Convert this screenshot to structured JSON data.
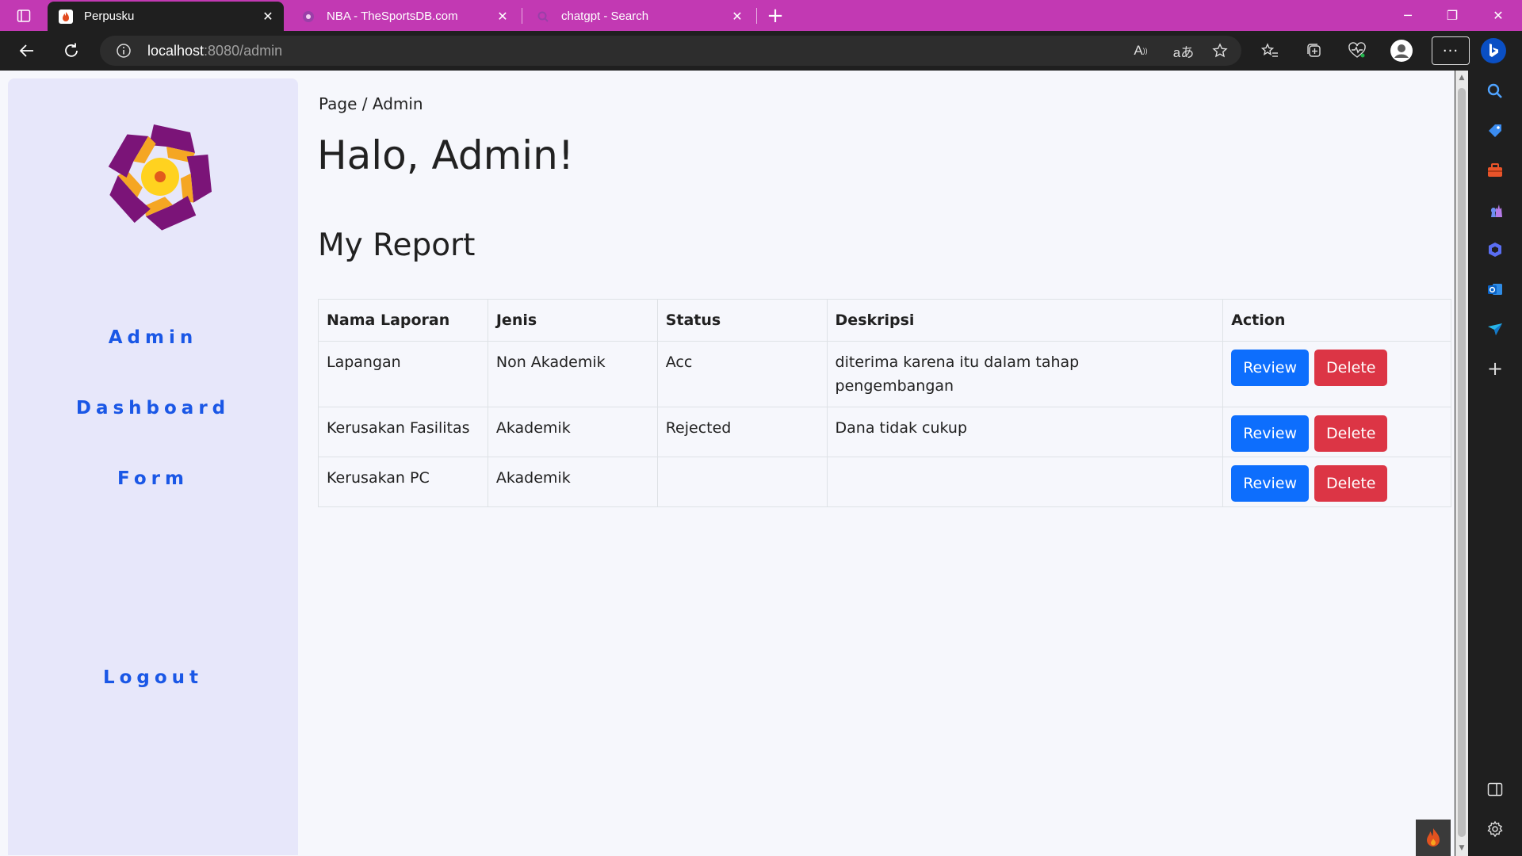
{
  "browser": {
    "tabs": [
      {
        "title": "Perpusku",
        "active": true,
        "icon": "fire-favicon-icon"
      },
      {
        "title": "NBA - TheSportsDB.com",
        "active": false,
        "icon": "sportsdb-favicon-icon"
      },
      {
        "title": "chatgpt - Search",
        "active": false,
        "icon": "search-favicon-icon"
      }
    ],
    "url_host": "localhost",
    "url_rest": ":8080/admin",
    "read_aloud_label": "A",
    "translate_label": "aあ",
    "titlebar_color": "#c239b3"
  },
  "sidebar": {
    "nav": [
      {
        "label": "Admin"
      },
      {
        "label": "Dashboard"
      },
      {
        "label": "Form"
      }
    ],
    "logout_label": "Logout",
    "accent": "#1a57e6"
  },
  "main": {
    "breadcrumb": "Page / Admin",
    "greeting": "Halo, Admin!",
    "section_title": "My Report",
    "table": {
      "headers": [
        "Nama Laporan",
        "Jenis",
        "Status",
        "Deskripsi",
        "Action"
      ],
      "rows": [
        {
          "nama": "Lapangan",
          "jenis": "Non Akademik",
          "status": "Acc",
          "deskripsi": "diterima karena itu dalam tahap pengembangan"
        },
        {
          "nama": "Kerusakan Fasilitas",
          "jenis": "Akademik",
          "status": "Rejected",
          "deskripsi": "Dana tidak cukup"
        },
        {
          "nama": "Kerusakan PC",
          "jenis": "Akademik",
          "status": "",
          "deskripsi": ""
        }
      ],
      "review_label": "Review",
      "delete_label": "Delete"
    }
  }
}
